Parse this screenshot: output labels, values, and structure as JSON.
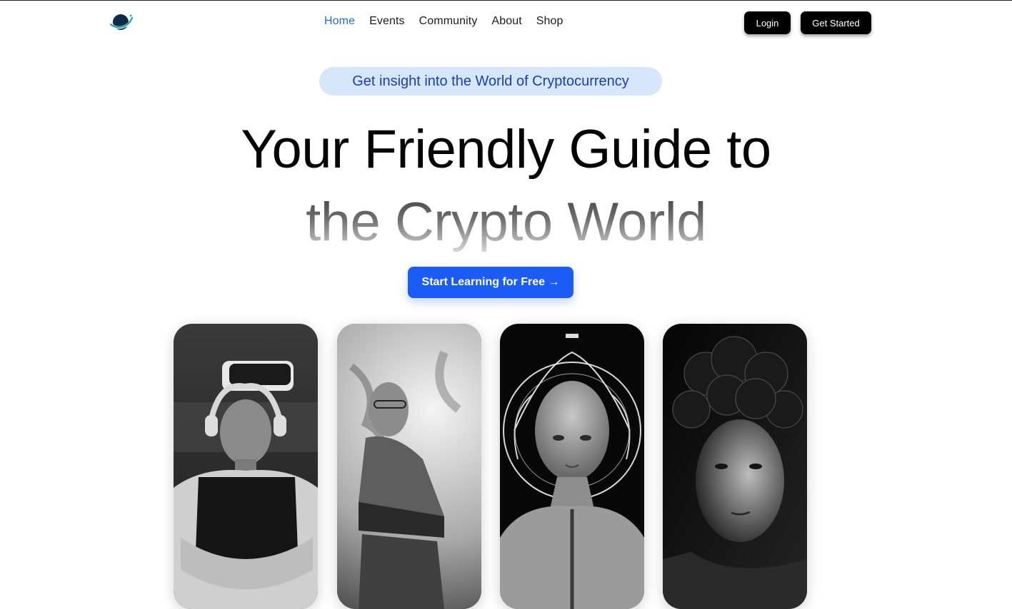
{
  "nav": {
    "links": [
      {
        "label": "Home",
        "active": true
      },
      {
        "label": "Events",
        "active": false
      },
      {
        "label": "Community",
        "active": false
      },
      {
        "label": "About",
        "active": false
      },
      {
        "label": "Shop",
        "active": false
      }
    ],
    "login_label": "Login",
    "get_started_label": "Get Started"
  },
  "hero": {
    "tagline": "Get insight into the World of Cryptocurrency",
    "title_line1": "Your Friendly Guide to",
    "title_line2": "the Crypto World",
    "cta_label": "Start Learning for Free →"
  },
  "cards": [
    {
      "icon": "vr-headset-man-photo"
    },
    {
      "icon": "woman-earth-photo"
    },
    {
      "icon": "android-portrait-photo"
    },
    {
      "icon": "curly-hair-man-photo"
    }
  ],
  "colors": {
    "accent": "#1a5cf5",
    "nav_active": "#1f6ad8",
    "pill_bg": "#d6e6fb",
    "pill_text": "#1a3fb0",
    "logo_navy": "#0f2a4a",
    "logo_teal": "#1aa79a"
  }
}
